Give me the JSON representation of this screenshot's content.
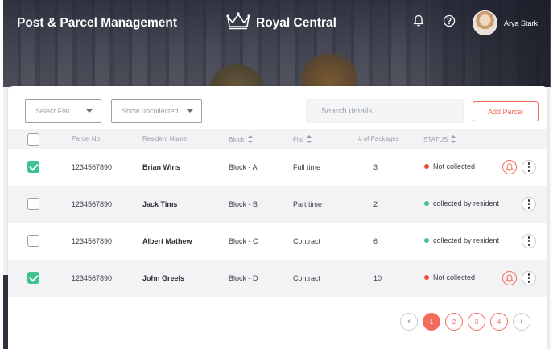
{
  "header": {
    "app_title": "Post & Parcel Management",
    "brand_name": "Royal Central",
    "user_name": "Arya Stark"
  },
  "filters": {
    "flat_select": "Select Flat",
    "status_select": "Show uncollected",
    "search_placeholder": "Search details",
    "add_button": "Add Parcel"
  },
  "table": {
    "columns": [
      "Parcel No.",
      "Resident Name",
      "Block",
      "Flat",
      "# of Packages",
      "STATUS"
    ],
    "rows": [
      {
        "parcel": "1234567890",
        "name": "Brian Wins",
        "block": "Block - A",
        "flat": "Full time",
        "packages": "3",
        "status": "Not collected",
        "checked": true,
        "bell": true
      },
      {
        "parcel": "1234567890",
        "name": "Jack Tims",
        "block": "Block - B",
        "flat": "Part time",
        "packages": "2",
        "status": "collected by resident",
        "checked": false,
        "bell": false
      },
      {
        "parcel": "1234567890",
        "name": "Albert Mathew",
        "block": "Block - C",
        "flat": "Contract",
        "packages": "6",
        "status": "collected by resident",
        "checked": false,
        "bell": false
      },
      {
        "parcel": "1234567890",
        "name": "John Greels",
        "block": "Block - D",
        "flat": "Contract",
        "packages": "10",
        "status": "Not collected",
        "checked": true,
        "bell": true
      }
    ]
  },
  "pagination": {
    "prev": "‹",
    "pages": [
      "1",
      "2",
      "3",
      "4"
    ],
    "next": "›",
    "active_page": "1"
  },
  "colors": {
    "accent": "#f26b5b",
    "status_not_collected": "#f0473a",
    "status_collected": "#3ec28f",
    "checkbox_checked": "#3ec28f"
  },
  "icons": {
    "crown": "crown-icon",
    "bell": "bell-icon",
    "help": "help-icon",
    "menu": "more-vertical-icon"
  }
}
